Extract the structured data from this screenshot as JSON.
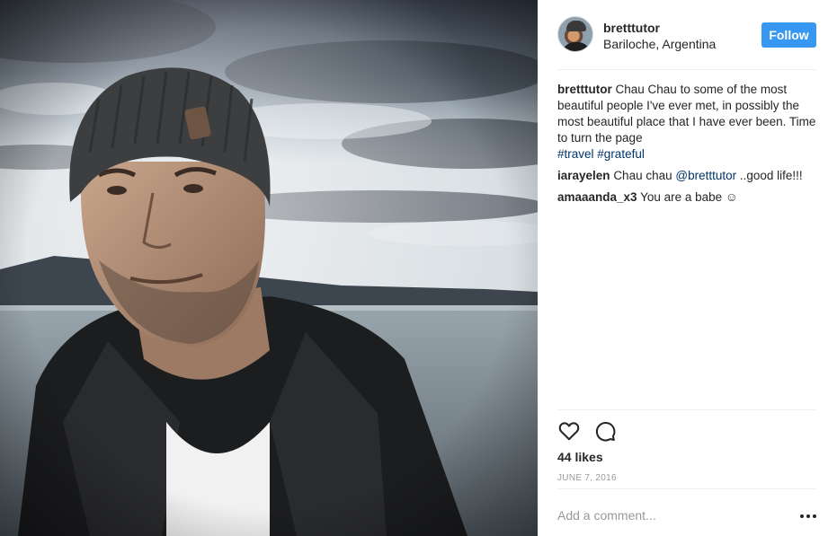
{
  "photo": {
    "alt_icon": "post-photo"
  },
  "header": {
    "username": "bretttutor",
    "location": "Bariloche, Argentina",
    "follow_label": "Follow"
  },
  "caption": {
    "username": "bretttutor",
    "text": "Chau Chau to some of the most beautiful people I've ever met, in possibly the most beautiful place that I have ever been. Time to turn the page",
    "hashtags": [
      "#travel",
      "#grateful"
    ]
  },
  "comments": [
    {
      "username": "iarayelen",
      "text_before": "Chau chau ",
      "mention": "@bretttutor",
      "text_after": " ..good life!!!"
    },
    {
      "username": "amaaanda_x3",
      "text": "You are a babe ☺"
    }
  ],
  "actions": {
    "like_icon": "heart-icon",
    "comment_icon": "comment-icon",
    "likes": "44 likes",
    "date": "JUNE 7, 2016"
  },
  "add_comment": {
    "placeholder": "Add a comment...",
    "more_icon": "more-options-icon"
  },
  "colors": {
    "follow_button": "#3897f0",
    "link": "#003569",
    "divider": "#efefef",
    "muted": "#999999"
  }
}
